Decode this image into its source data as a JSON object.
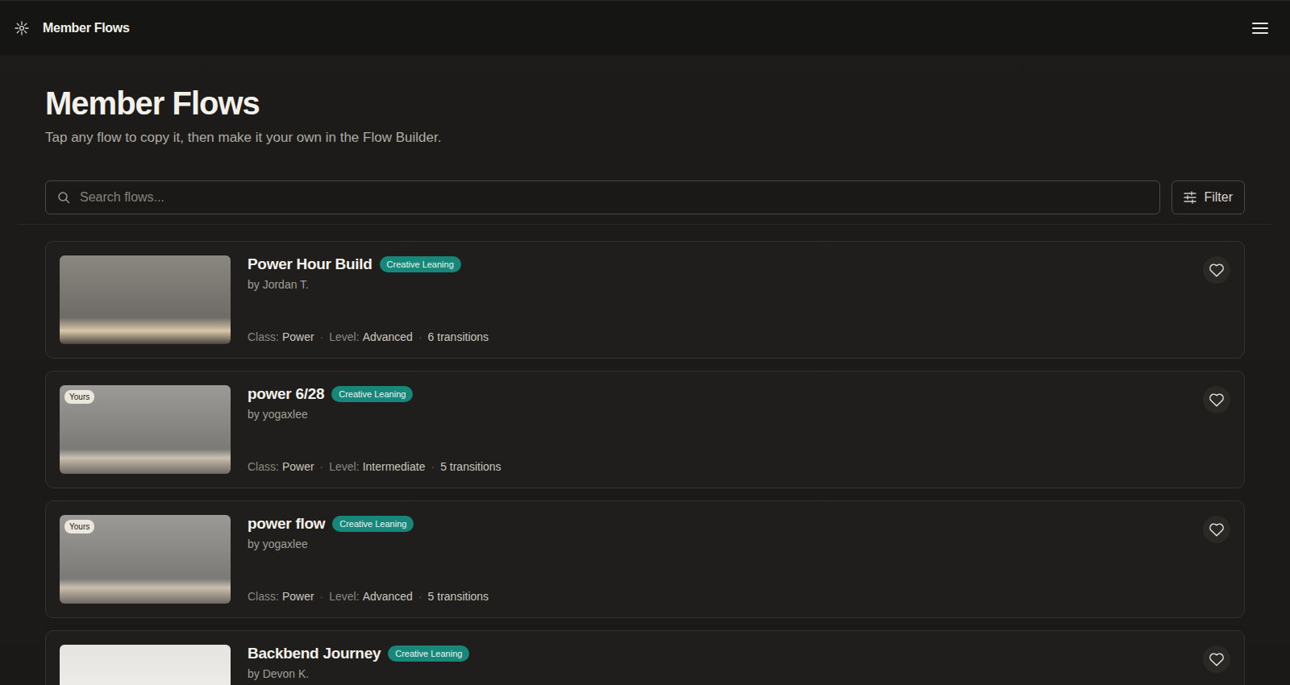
{
  "header": {
    "title": "Member Flows"
  },
  "page": {
    "title": "Member Flows",
    "subtitle": "Tap any flow to copy it, then make it your own in the Flow Builder."
  },
  "search": {
    "placeholder": "Search flows...",
    "filter_label": "Filter"
  },
  "meta_labels": {
    "class": "Class:",
    "level": "Level:",
    "separator": "·"
  },
  "flows": [
    {
      "title": "Power Hour Build",
      "tag": "Creative Leaning",
      "author": "by Jordan T.",
      "badge": "",
      "liked": false,
      "meta": {
        "class": "Power",
        "level": "Advanced",
        "transitions": "6 transitions"
      }
    },
    {
      "title": "power 6/28",
      "tag": "Creative Leaning",
      "author": "by yogaxlee",
      "badge": "Yours",
      "liked": false,
      "meta": {
        "class": "Power",
        "level": "Intermediate",
        "transitions": "5 transitions"
      }
    },
    {
      "title": "power flow",
      "tag": "Creative Leaning",
      "author": "by yogaxlee",
      "badge": "Yours",
      "liked": false,
      "meta": {
        "class": "Power",
        "level": "Advanced",
        "transitions": "5 transitions"
      }
    },
    {
      "title": "Backbend Journey",
      "tag": "Creative Leaning",
      "author": "by Devon K.",
      "badge": "",
      "liked": false,
      "meta": null
    }
  ]
}
